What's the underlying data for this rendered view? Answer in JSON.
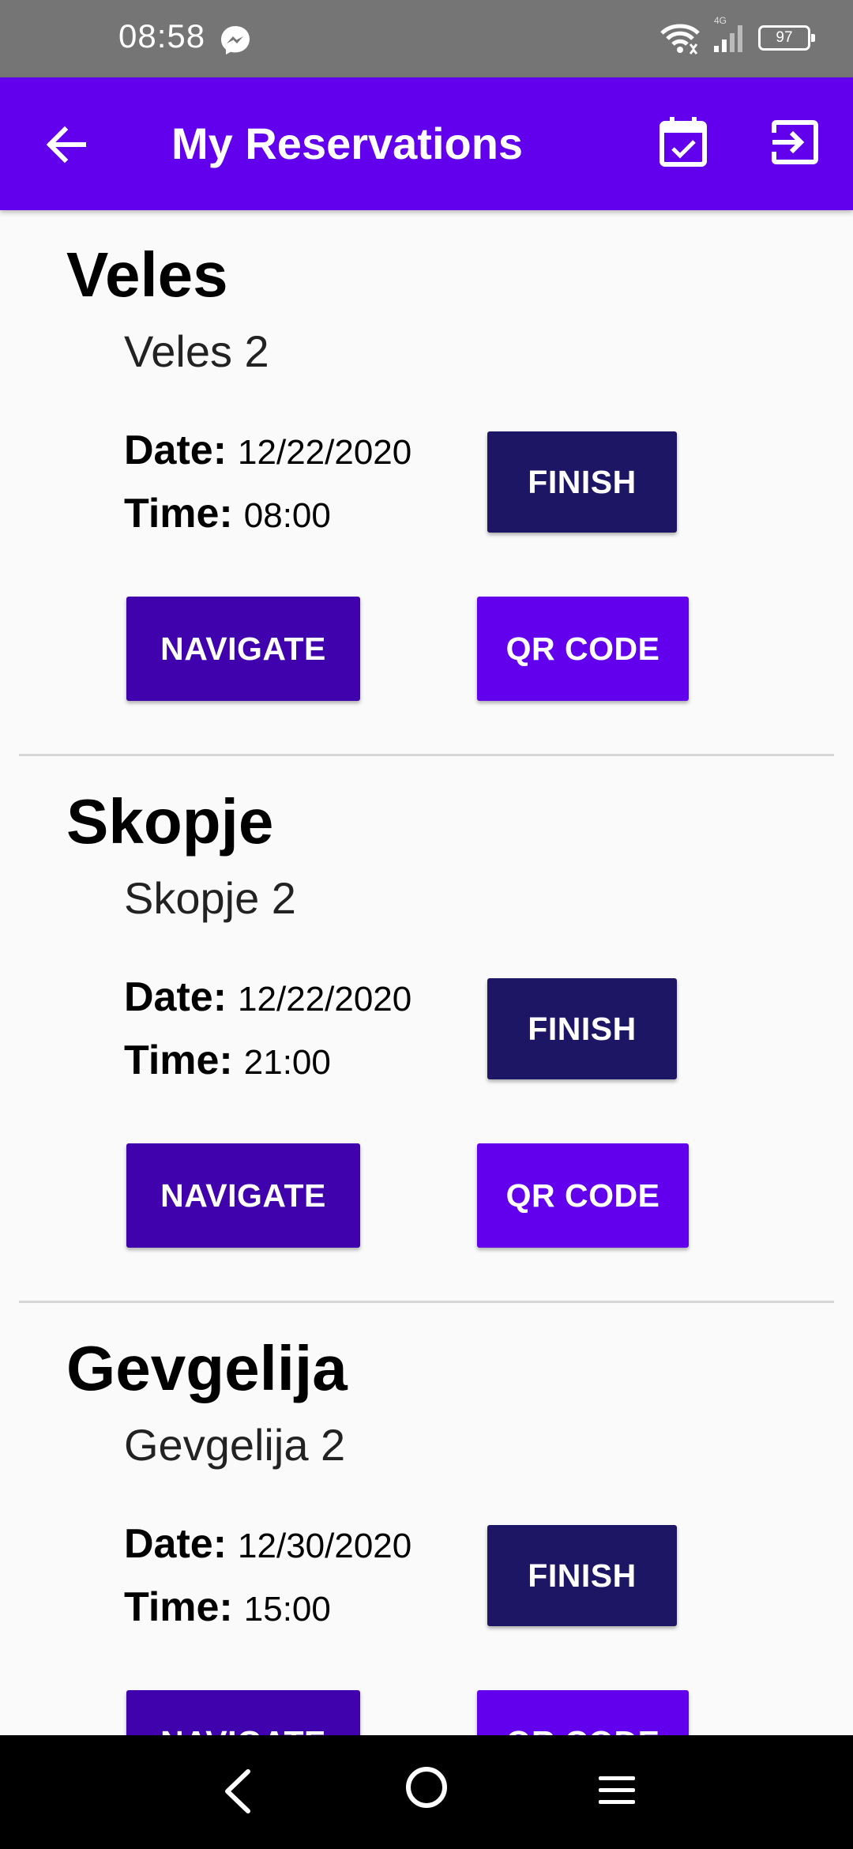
{
  "status_bar": {
    "time": "08:58",
    "network": "4G",
    "battery": "97",
    "icons": [
      "messenger-icon",
      "wifi-icon",
      "signal-icon",
      "battery-icon"
    ]
  },
  "app_bar": {
    "title": "My Reservations",
    "color": "#6200ee",
    "icons": [
      "arrow-back-icon",
      "calendar-check-icon",
      "exit-to-app-icon"
    ]
  },
  "labels": {
    "date": "Date:",
    "time": "Time:"
  },
  "reservations": [
    {
      "city": "Veles",
      "branch": "Veles 2",
      "date": "12/22/2020",
      "time": "08:00",
      "finish_label": "FINISH",
      "navigate_label": "NAVIGATE",
      "qr_label": "QR CODE"
    },
    {
      "city": "Skopje",
      "branch": "Skopje 2",
      "date": "12/22/2020",
      "time": "21:00",
      "finish_label": "FINISH",
      "navigate_label": "NAVIGATE",
      "qr_label": "QR CODE"
    },
    {
      "city": "Gevgelija",
      "branch": "Gevgelija 2",
      "date": "12/30/2020",
      "time": "15:00",
      "finish_label": "FINISH",
      "navigate_label": "NAVIGATE",
      "qr_label": "QR CODE"
    }
  ],
  "colors": {
    "finish_button": "#1d1664",
    "navigate_button": "#3f02ad",
    "qr_button": "#6200ee"
  },
  "nav_bar": {
    "icons": [
      "nav-back-icon",
      "nav-home-icon",
      "nav-menu-icon"
    ]
  }
}
